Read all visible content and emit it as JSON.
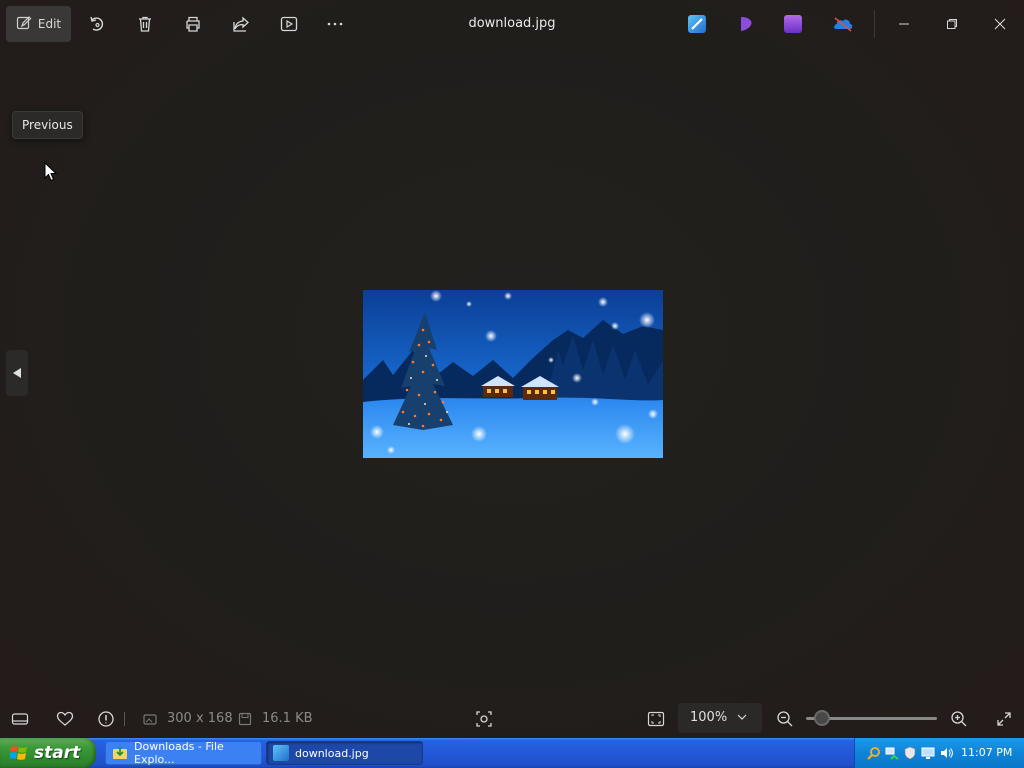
{
  "window": {
    "title": "download.jpg",
    "edit_label": "Edit"
  },
  "toolbar_icons": [
    "edit-icon",
    "rotate-icon",
    "delete-icon",
    "print-icon",
    "share-icon",
    "slideshow-icon",
    "more-icon"
  ],
  "app_icons": [
    "photos-editor-icon",
    "clipchamp-icon",
    "video-editor-icon",
    "onedrive-icon"
  ],
  "tooltip": {
    "text": "Previous"
  },
  "bottom": {
    "dimensions": "300 x 168",
    "file_size": "16.1 KB",
    "zoom_value": "100%",
    "zoom_level_fraction": 0.12
  },
  "taskbar": {
    "start_label": "start",
    "tasks": [
      {
        "label": "Downloads - File Explo...",
        "active": false
      },
      {
        "label": "download.jpg",
        "active": true
      }
    ],
    "clock": "11:07 PM"
  },
  "colors": {
    "background": "#211d1b",
    "taskbar_blue": "#2358d8",
    "start_green": "#3c9a3a",
    "tray_blue": "#0f84d8"
  }
}
